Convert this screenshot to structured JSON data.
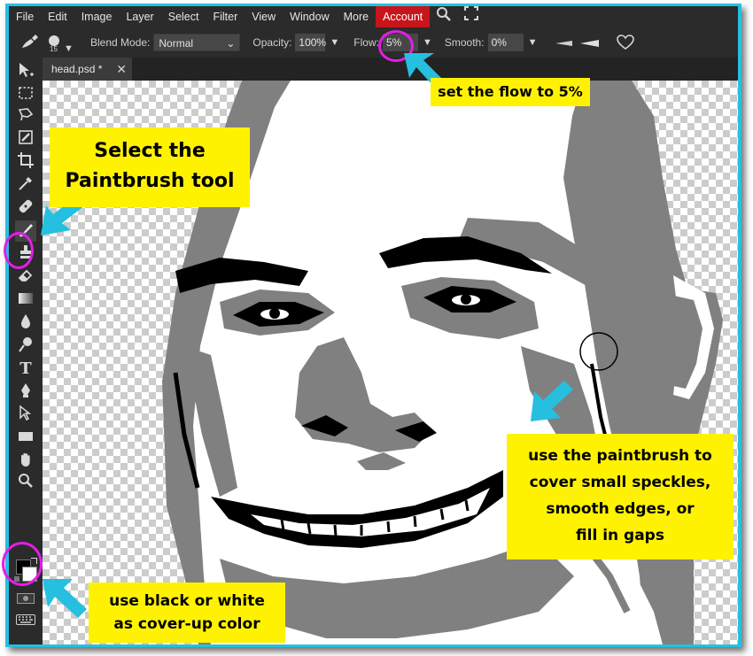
{
  "menu": {
    "items": [
      "File",
      "Edit",
      "Image",
      "Layer",
      "Select",
      "Filter",
      "View",
      "Window",
      "More"
    ],
    "account": "Account"
  },
  "options": {
    "brush_size": "15",
    "blend_mode_label": "Blend Mode:",
    "blend_mode_value": "Normal",
    "opacity_label": "Opacity:",
    "opacity_value": "100%",
    "flow_label": "Flow:",
    "flow_value": "5%",
    "smooth_label": "Smooth:",
    "smooth_value": "0%"
  },
  "document": {
    "tab_label": "head.psd *",
    "close_glyph": "✕"
  },
  "annotations": {
    "flow_note": "set the flow to 5%",
    "tool_note": [
      "Select the",
      "Paintbrush tool"
    ],
    "color_note": [
      "use black or white",
      "as cover-up color"
    ],
    "brush_note": [
      "use the paintbrush to",
      "cover small speckles,",
      "smooth edges, or",
      "fill in gaps"
    ]
  },
  "colors": {
    "accent_cyan": "#26bfe0",
    "ring_magenta": "#e21ee6",
    "callout_yellow": "#fff200",
    "account_red": "#c8151b"
  }
}
